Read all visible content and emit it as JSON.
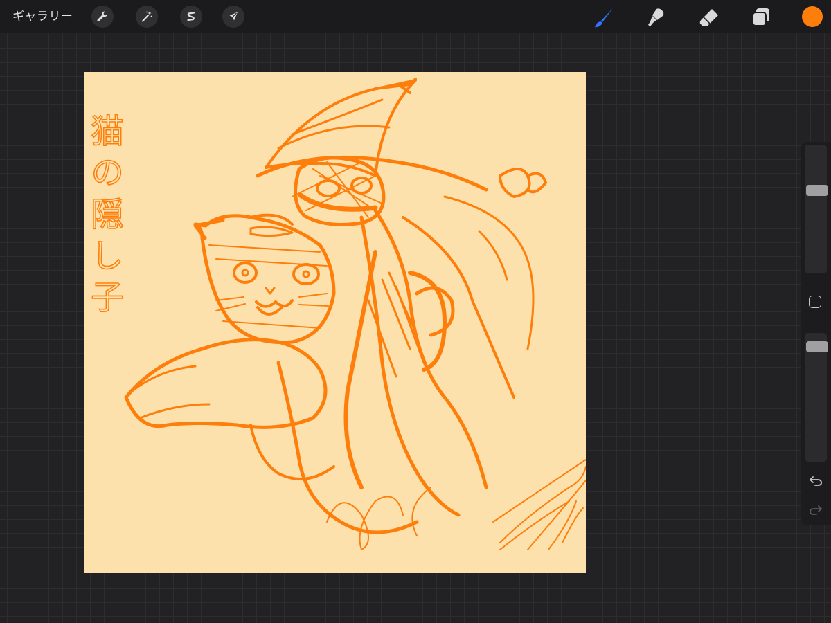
{
  "topbar": {
    "gallery_label": "ギャラリー",
    "left_tools": [
      {
        "icon": "wrench-icon",
        "name": "actions"
      },
      {
        "icon": "magic-wand-icon",
        "name": "adjustments"
      },
      {
        "icon": "selection-s-icon",
        "name": "selection"
      },
      {
        "icon": "transform-arrow-icon",
        "name": "transform"
      }
    ],
    "right_tools": [
      {
        "icon": "brush-icon",
        "name": "paint",
        "active": true
      },
      {
        "icon": "smudge-icon",
        "name": "smudge",
        "active": false
      },
      {
        "icon": "eraser-icon",
        "name": "erase",
        "active": false
      },
      {
        "icon": "layers-icon",
        "name": "layers",
        "active": false
      }
    ],
    "current_color": "#fe7e0c"
  },
  "canvas": {
    "background_color": "#fde1ac",
    "stroke_color": "#fe7e0c",
    "handwritten_text": "猫の隠し子"
  },
  "sidebar": {
    "brush_size_level": 0.34,
    "opacity_level": 0.07,
    "icons": [
      "modify-square-icon",
      "undo-icon",
      "redo-icon"
    ]
  },
  "colors": {
    "background": "#222224",
    "topbar": "#1b1b1d",
    "active_tool": "#2f74ff",
    "inactive_tool": "#d9d9dc"
  }
}
